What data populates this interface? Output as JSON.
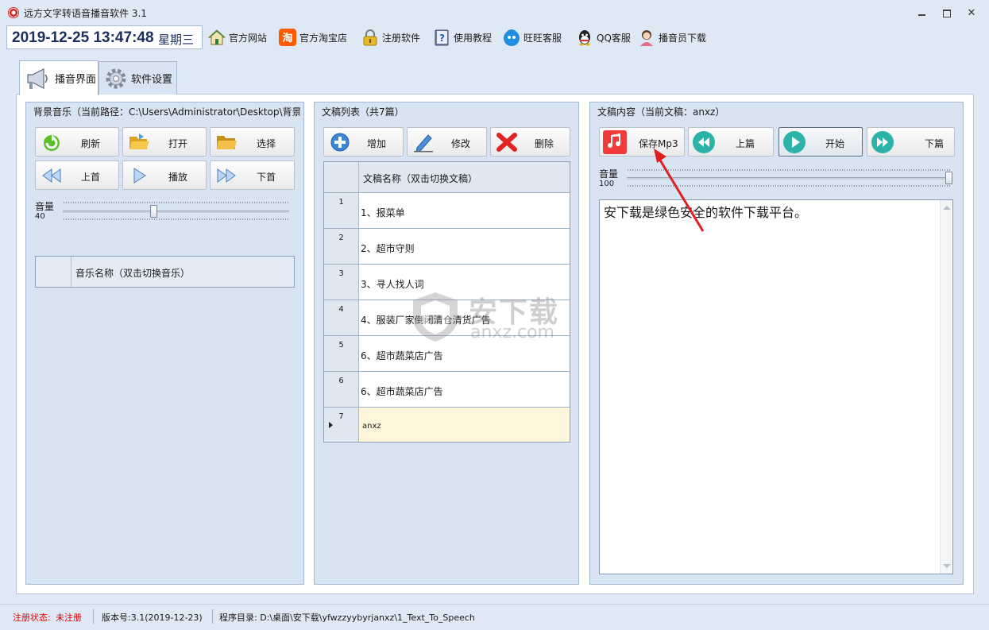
{
  "window": {
    "title": "远方文字转语音播音软件 3.1"
  },
  "toolbar": {
    "datetime": "2019-12-25 13:47:48",
    "weekday": "星期三",
    "items": [
      {
        "label": "官方网站",
        "icon": "home-icon"
      },
      {
        "label": "官方淘宝店",
        "icon": "taobao-icon"
      },
      {
        "label": "注册软件",
        "icon": "lock-icon"
      },
      {
        "label": "使用教程",
        "icon": "help-book-icon"
      },
      {
        "label": "旺旺客服",
        "icon": "wangwang-icon"
      },
      {
        "label": "QQ客服",
        "icon": "qq-icon"
      },
      {
        "label": "播音员下载",
        "icon": "announcer-icon"
      }
    ]
  },
  "tabs": [
    {
      "label": "播音界面",
      "icon": "loudspeaker-icon",
      "active": true
    },
    {
      "label": "软件设置",
      "icon": "gear-icon",
      "active": false
    }
  ],
  "bg_music": {
    "title": "背景音乐（当前路径：C:\\Users\\Administrator\\Desktop\\背景",
    "buttons": {
      "refresh": "刷新",
      "open": "打开",
      "select": "选择",
      "prev": "上首",
      "play": "播放",
      "next": "下首"
    },
    "volume_label": "音量",
    "volume_value": "40",
    "volume_level": 40,
    "table_header": "音乐名称（双击切换音乐）"
  },
  "doc_list": {
    "title": "文稿列表（共7篇）",
    "buttons": {
      "add": "增加",
      "edit": "修改",
      "delete": "删除"
    },
    "table_header": "文稿名称（双击切换文稿）",
    "rows": [
      {
        "num": "1",
        "name": "1、报菜单"
      },
      {
        "num": "2",
        "name": "2、超市守则"
      },
      {
        "num": "3",
        "name": "3、寻人找人词"
      },
      {
        "num": "4",
        "name": "4、服装厂家倒闭清仓清货广告"
      },
      {
        "num": "5",
        "name": "6、超市蔬菜店广告"
      },
      {
        "num": "6",
        "name": "6、超市蔬菜店广告"
      },
      {
        "num": "7",
        "name": "anxz"
      }
    ],
    "selected_row": 7
  },
  "doc_content": {
    "title": "文稿内容（当前文稿：anxz）",
    "buttons": {
      "save_mp3": "保存Mp3",
      "prev": "上篇",
      "start": "开始",
      "next": "下篇"
    },
    "volume_label": "音量",
    "volume_value": "100",
    "volume_level": 100,
    "text": "安下载是绿色安全的软件下载平台。"
  },
  "watermark": {
    "cn": "安下载",
    "en": "anxz.com"
  },
  "status": {
    "reg_label": "注册状态:",
    "reg_value": "未注册",
    "version": "版本号:3.1(2019-12-23)",
    "dir": "程序目录: D:\\桌面\\安下载\\yfwzzyybyrjanxz\\1_Text_To_Speech"
  },
  "colors": {
    "panel_bg": "#d8e4f2",
    "accent_red": "#e53935",
    "teal_button": "#2ab3a6",
    "selected_row": "#fdf5dc",
    "unregistered": "#e00000"
  }
}
